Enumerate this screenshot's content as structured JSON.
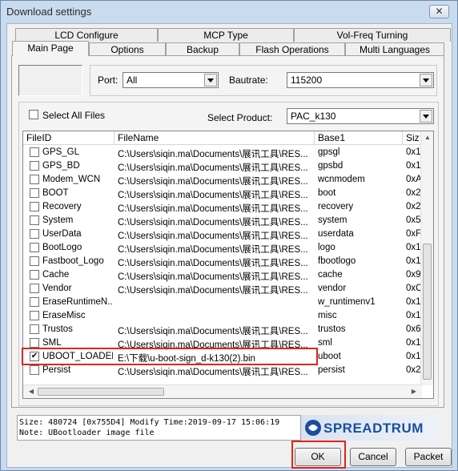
{
  "window": {
    "title": "Download settings",
    "close_glyph": "✕"
  },
  "tabs": {
    "back": [
      "LCD Configure",
      "MCP Type",
      "Vol-Freq Turning"
    ],
    "front": [
      "Main Page",
      "Options",
      "Backup",
      "Flash Operations",
      "Multi Languages"
    ]
  },
  "port": {
    "label": "Port:",
    "value": "All"
  },
  "bautrate": {
    "label": "Bautrate:",
    "value": "115200"
  },
  "select_all": {
    "label": "Select All Files",
    "checked": false
  },
  "product": {
    "label": "Select Product:",
    "value": "PAC_k130"
  },
  "columns": [
    "FileID",
    "FileName",
    "Base1",
    "Siz"
  ],
  "rows": [
    {
      "id": "GPS_GL",
      "file": "C:\\Users\\siqin.ma\\Documents\\展讯工具\\RES...",
      "base": "gpsgl",
      "size": "0x1",
      "checked": false
    },
    {
      "id": "GPS_BD",
      "file": "C:\\Users\\siqin.ma\\Documents\\展讯工具\\RES...",
      "base": "gpsbd",
      "size": "0x1",
      "checked": false
    },
    {
      "id": "Modem_WCN",
      "file": "C:\\Users\\siqin.ma\\Documents\\展讯工具\\RES...",
      "base": "wcnmodem",
      "size": "0xA",
      "checked": false
    },
    {
      "id": "BOOT",
      "file": "C:\\Users\\siqin.ma\\Documents\\展讯工具\\RES...",
      "base": "boot",
      "size": "0x2",
      "checked": false
    },
    {
      "id": "Recovery",
      "file": "C:\\Users\\siqin.ma\\Documents\\展讯工具\\RES...",
      "base": "recovery",
      "size": "0x2",
      "checked": false
    },
    {
      "id": "System",
      "file": "C:\\Users\\siqin.ma\\Documents\\展讯工具\\RES...",
      "base": "system",
      "size": "0x5",
      "checked": false
    },
    {
      "id": "UserData",
      "file": "C:\\Users\\siqin.ma\\Documents\\展讯工具\\RES...",
      "base": "userdata",
      "size": "0xF",
      "checked": false
    },
    {
      "id": "BootLogo",
      "file": "C:\\Users\\siqin.ma\\Documents\\展讯工具\\RES...",
      "base": "logo",
      "size": "0x1",
      "checked": false
    },
    {
      "id": "Fastboot_Logo",
      "file": "C:\\Users\\siqin.ma\\Documents\\展讯工具\\RES...",
      "base": "fbootlogo",
      "size": "0x1",
      "checked": false
    },
    {
      "id": "Cache",
      "file": "C:\\Users\\siqin.ma\\Documents\\展讯工具\\RES...",
      "base": "cache",
      "size": "0x9",
      "checked": false
    },
    {
      "id": "Vendor",
      "file": "C:\\Users\\siqin.ma\\Documents\\展讯工具\\RES...",
      "base": "vendor",
      "size": "0xC",
      "checked": false
    },
    {
      "id": "EraseRuntimeN...",
      "file": "",
      "base": "w_runtimenv1",
      "size": "0x1",
      "checked": false
    },
    {
      "id": "EraseMisc",
      "file": "",
      "base": "misc",
      "size": "0x1",
      "checked": false
    },
    {
      "id": "Trustos",
      "file": "C:\\Users\\siqin.ma\\Documents\\展讯工具\\RES...",
      "base": "trustos",
      "size": "0x6",
      "checked": false
    },
    {
      "id": "SML",
      "file": "C:\\Users\\siqin.ma\\Documents\\展讯工具\\RES...",
      "base": "sml",
      "size": "0x1",
      "checked": false
    },
    {
      "id": "UBOOT_LOADER",
      "file": "E:\\下载\\u-boot-sign_d-k130(2).bin",
      "base": "uboot",
      "size": "0x1",
      "checked": true
    },
    {
      "id": "Persist",
      "file": "C:\\Users\\siqin.ma\\Documents\\展讯工具\\RES...",
      "base": "persist",
      "size": "0x2",
      "checked": false
    }
  ],
  "status": {
    "line1": "Size: 480724   [0x755D4] Modify Time:2019-09-17 15:06:19",
    "line2": "Note: UBootloader image file"
  },
  "logo_text": "SPREADTRUM",
  "buttons": {
    "ok": "OK",
    "cancel": "Cancel",
    "packet": "Packet"
  },
  "colors": {
    "highlight": "#e0241c",
    "brand": "#1a4e9c"
  }
}
